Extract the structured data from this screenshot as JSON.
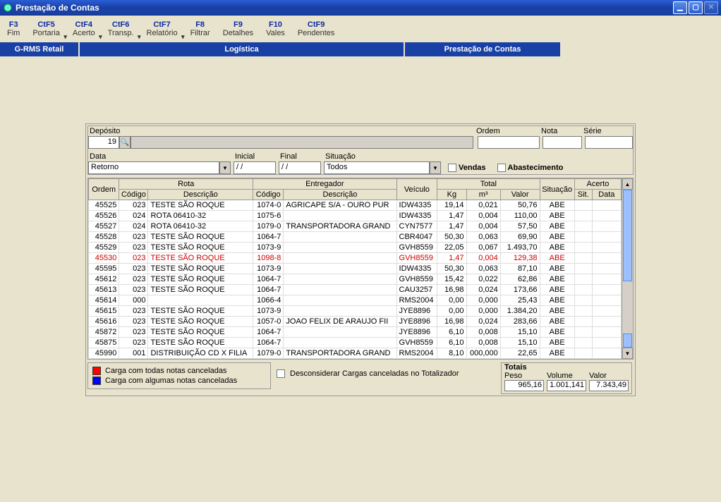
{
  "window": {
    "title": "Prestação de Contas"
  },
  "toolbar": [
    {
      "key": "F3",
      "label": "Fim",
      "dropdown": false
    },
    {
      "key": "CtF5",
      "label": "Portaria",
      "dropdown": true
    },
    {
      "key": "CtF4",
      "label": "Acerto",
      "dropdown": true
    },
    {
      "key": "CtF6",
      "label": "Transp.",
      "dropdown": true
    },
    {
      "key": "CtF7",
      "label": "Relatório",
      "dropdown": true
    },
    {
      "key": "F8",
      "label": "Filtrar",
      "dropdown": false
    },
    {
      "key": "F9",
      "label": "Detalhes",
      "dropdown": false
    },
    {
      "key": "F10",
      "label": "Vales",
      "dropdown": false
    },
    {
      "key": "CtF9",
      "label": "Pendentes",
      "dropdown": false
    }
  ],
  "crumb": {
    "seg1": "G-RMS Retail",
    "seg2": "Logística",
    "seg3": "Prestação de Contas"
  },
  "filters": {
    "deposito_label": "Depósito",
    "deposito_value": "19",
    "ordem_label": "Ordem",
    "ordem_value": "",
    "nota_label": "Nota",
    "nota_value": "",
    "serie_label": "Série",
    "serie_value": "",
    "data_label": "Data",
    "data_combo": "Retorno",
    "inicial_label": "Inicial",
    "inicial_value": "/  /",
    "final_label": "Final",
    "final_value": "/  /",
    "situacao_label": "Situação",
    "situacao_combo": "Todos",
    "chk_vendas": "Vendas",
    "chk_abastecimento": "Abastecimento"
  },
  "table": {
    "headers": {
      "ordem": "Ordem",
      "rota": "Rota",
      "rota_codigo": "Código",
      "rota_descricao": "Descrição",
      "entregador": "Entregador",
      "ent_codigo": "Código",
      "ent_descricao": "Descrição",
      "veiculo": "Veículo",
      "total": "Total",
      "total_kg": "Kg",
      "total_m3": "m³",
      "total_valor": "Valor",
      "situacao": "Situação",
      "acerto": "Acerto",
      "acerto_sit": "Sit.",
      "acerto_data": "Data"
    },
    "rows": [
      {
        "ordem": "45525",
        "rc": "023",
        "rd": "TESTE SÃO  ROQUE",
        "ec": "1074-0",
        "ed": "AGRICAPE S/A - OURO PUR",
        "veic": "IDW4335",
        "kg": "19,14",
        "m3": "0,021",
        "valor": "50,76",
        "sit": "ABE",
        "red": false
      },
      {
        "ordem": "45526",
        "rc": "024",
        "rd": "ROTA 06410-32",
        "ec": "1075-6",
        "ed": "",
        "veic": "IDW4335",
        "kg": "1,47",
        "m3": "0,004",
        "valor": "110,00",
        "sit": "ABE",
        "red": false
      },
      {
        "ordem": "45527",
        "rc": "024",
        "rd": "ROTA 06410-32",
        "ec": "1079-0",
        "ed": "TRANSPORTADORA GRAND",
        "veic": "CYN7577",
        "kg": "1,47",
        "m3": "0,004",
        "valor": "57,50",
        "sit": "ABE",
        "red": false
      },
      {
        "ordem": "45528",
        "rc": "023",
        "rd": "TESTE SÃO  ROQUE",
        "ec": "1064-7",
        "ed": "",
        "veic": "CBR4047",
        "kg": "50,30",
        "m3": "0,063",
        "valor": "69,90",
        "sit": "ABE",
        "red": false
      },
      {
        "ordem": "45529",
        "rc": "023",
        "rd": "TESTE SÃO  ROQUE",
        "ec": "1073-9",
        "ed": "",
        "veic": "GVH8559",
        "kg": "22,05",
        "m3": "0,067",
        "valor": "1.493,70",
        "sit": "ABE",
        "red": false
      },
      {
        "ordem": "45530",
        "rc": "023",
        "rd": "TESTE SÃO  ROQUE",
        "ec": "1098-8",
        "ed": "",
        "veic": "GVH8559",
        "kg": "1,47",
        "m3": "0,004",
        "valor": "129,38",
        "sit": "ABE",
        "red": true
      },
      {
        "ordem": "45595",
        "rc": "023",
        "rd": "TESTE SÃO  ROQUE",
        "ec": "1073-9",
        "ed": "",
        "veic": "IDW4335",
        "kg": "50,30",
        "m3": "0,063",
        "valor": "87,10",
        "sit": "ABE",
        "red": false
      },
      {
        "ordem": "45612",
        "rc": "023",
        "rd": "TESTE SÃO  ROQUE",
        "ec": "1064-7",
        "ed": "",
        "veic": "GVH8559",
        "kg": "15,42",
        "m3": "0,022",
        "valor": "62,86",
        "sit": "ABE",
        "red": false
      },
      {
        "ordem": "45613",
        "rc": "023",
        "rd": "TESTE SÃO  ROQUE",
        "ec": "1064-7",
        "ed": "",
        "veic": "CAU3257",
        "kg": "16,98",
        "m3": "0,024",
        "valor": "173,66",
        "sit": "ABE",
        "red": false
      },
      {
        "ordem": "45614",
        "rc": "000",
        "rd": "",
        "ec": "1066-4",
        "ed": "",
        "veic": "RMS2004",
        "kg": "0,00",
        "m3": "0,000",
        "valor": "25,43",
        "sit": "ABE",
        "red": false
      },
      {
        "ordem": "45615",
        "rc": "023",
        "rd": "TESTE SÃO  ROQUE",
        "ec": "1073-9",
        "ed": "",
        "veic": "JYE8896",
        "kg": "0,00",
        "m3": "0,000",
        "valor": "1.384,20",
        "sit": "ABE",
        "red": false
      },
      {
        "ordem": "45616",
        "rc": "023",
        "rd": "TESTE SÃO  ROQUE",
        "ec": "1057-0",
        "ed": "JOAO FELIX DE ARAUJO FII",
        "veic": "JYE8896",
        "kg": "16,98",
        "m3": "0,024",
        "valor": "283,66",
        "sit": "ABE",
        "red": false
      },
      {
        "ordem": "45872",
        "rc": "023",
        "rd": "TESTE SÃO  ROQUE",
        "ec": "1064-7",
        "ed": "",
        "veic": "JYE8896",
        "kg": "6,10",
        "m3": "0,008",
        "valor": "15,10",
        "sit": "ABE",
        "red": false
      },
      {
        "ordem": "45875",
        "rc": "023",
        "rd": "TESTE SÃO  ROQUE",
        "ec": "1064-7",
        "ed": "",
        "veic": "GVH8559",
        "kg": "6,10",
        "m3": "0,008",
        "valor": "15,10",
        "sit": "ABE",
        "red": false
      },
      {
        "ordem": "45990",
        "rc": "001",
        "rd": "DISTRIBUIÇÃO CD X FILIA",
        "ec": "1079-0",
        "ed": "TRANSPORTADORA GRAND",
        "veic": "RMS2004",
        "kg": "8,10",
        "m3": "000,000",
        "valor": "22,65",
        "sit": "ABE",
        "red": false
      }
    ]
  },
  "legend": {
    "all_cancel": "Carga com todas notas canceladas",
    "some_cancel": "Carga com algumas notas canceladas"
  },
  "footer_chk": "Desconsiderar Cargas canceladas no Totalizador",
  "totals": {
    "title": "Totais",
    "peso_label": "Peso",
    "peso": "965,16",
    "volume_label": "Volume",
    "volume": "1.001,141",
    "valor_label": "Valor",
    "valor": "7.343,49"
  }
}
